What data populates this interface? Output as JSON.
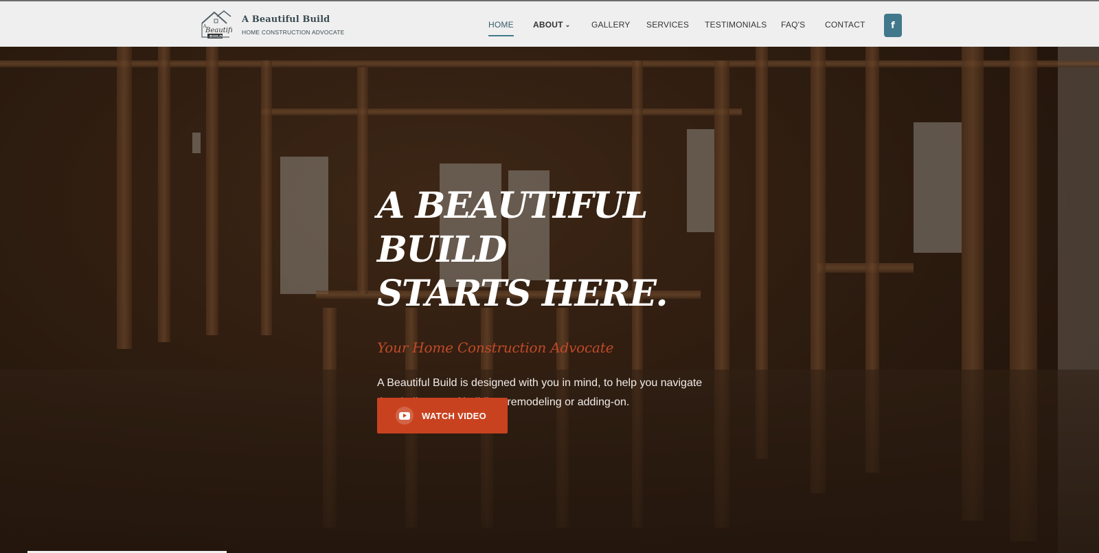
{
  "header": {
    "brand_title": "A Beautiful Build",
    "brand_subtitle": "HOME CONSTRUCTION ADVOCATE",
    "logo_text": [
      "A",
      "Beautiful",
      "BUILD"
    ]
  },
  "nav": {
    "home": "HOME",
    "about": "ABOUT",
    "gallery": "GALLERY",
    "services": "SERVICES",
    "testimonials": "TESTIMONIALS",
    "faqs": "FAQ'S",
    "contact": "CONTACT",
    "facebook_icon": "f"
  },
  "hero": {
    "headline_line1": "A BEAUTIFUL BUILD",
    "headline_line2": "STARTS HERE.",
    "tagline": "Your Home Construction Advocate",
    "description": "A Beautiful Build is designed with you in mind, to help you navigate the challenges of building, remodeling or adding-on.",
    "cta_label": "WATCH VIDEO"
  },
  "colors": {
    "accent": "#c9421f",
    "facebook": "#41788b",
    "nav_active": "#3f7b8c"
  }
}
